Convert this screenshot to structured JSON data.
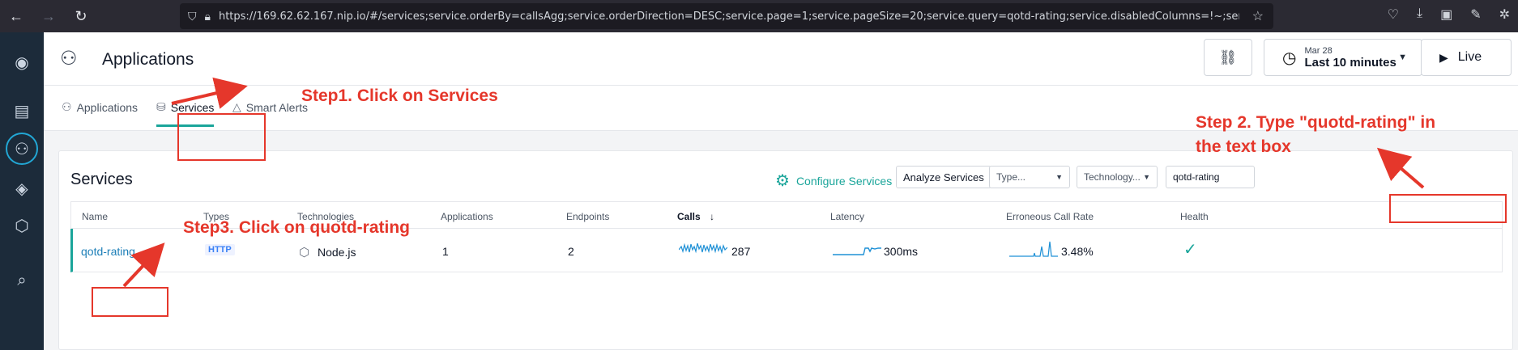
{
  "browser": {
    "url": "https://169.62.62.167.nip.io/#/services;service.orderBy=callsAgg;service.orderDirection=DESC;service.page=1;service.pageSize=20;service.query=qotd-rating;service.disabledColumns=!~;service.e"
  },
  "header": {
    "title": "Applications",
    "time_date": "Mar 28",
    "time_range": "Last 10 minutes",
    "live_label": "Live"
  },
  "tabs": [
    {
      "label": "Applications"
    },
    {
      "label": "Services"
    },
    {
      "label": "Smart Alerts"
    }
  ],
  "services": {
    "title": "Services",
    "configure_label": "Configure Services",
    "analyze_label": "Analyze Services",
    "type_placeholder": "Type...",
    "tech_placeholder": "Technology...",
    "search_value": "qotd-rating",
    "columns": [
      "Name",
      "Types",
      "Technologies",
      "Applications",
      "Endpoints",
      "Calls",
      "Latency",
      "Erroneous Call Rate",
      "Health"
    ],
    "rows": [
      {
        "name": "qotd-rating",
        "type": "HTTP",
        "technology": "Node.js",
        "applications": "1",
        "endpoints": "2",
        "calls": "287",
        "latency": "300ms",
        "error_rate": "3.48%"
      }
    ]
  },
  "annotations": {
    "step1": "Step1. Click on Services",
    "step2_line1": "Step 2. Type \"quotd-rating\" in",
    "step2_line2": "the text box",
    "step3": "Step3. Click on quotd-rating"
  },
  "colors": {
    "accent": "#1aa59a",
    "annotation": "#e5372b",
    "rail": "#1c2b3a",
    "link": "#1d7fb8"
  }
}
